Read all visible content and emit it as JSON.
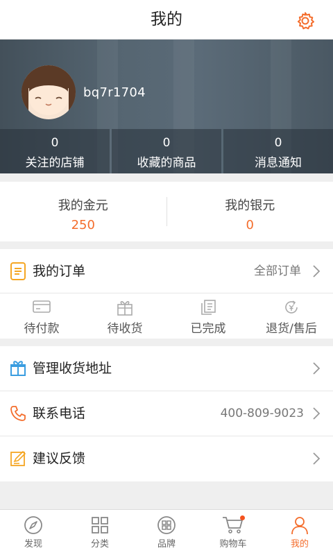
{
  "header": {
    "title": "我的",
    "settings_icon": "gear-icon"
  },
  "profile": {
    "username": "bq7r1704",
    "avatar_icon": "avatar-girl-icon"
  },
  "stats": [
    {
      "value": "0",
      "label": "关注的店铺"
    },
    {
      "value": "0",
      "label": "收藏的商品"
    },
    {
      "value": "0",
      "label": "消息通知"
    }
  ],
  "wallet": {
    "gold_label": "我的金元",
    "gold_value": "250",
    "silver_label": "我的银元",
    "silver_value": "0"
  },
  "orders": {
    "title": "我的订单",
    "all_label": "全部订单",
    "tabs": [
      {
        "label": "待付款",
        "icon": "card-icon"
      },
      {
        "label": "待收货",
        "icon": "gift-box-icon"
      },
      {
        "label": "已完成",
        "icon": "documents-icon"
      },
      {
        "label": "退货/售后",
        "icon": "refund-icon"
      }
    ]
  },
  "menu": [
    {
      "label": "管理收货地址",
      "right": "",
      "icon": "gift-icon"
    },
    {
      "label": "联系电话",
      "right": "400-809-9023",
      "icon": "phone-icon"
    },
    {
      "label": "建议反馈",
      "right": "",
      "icon": "feedback-icon"
    }
  ],
  "tabbar": [
    {
      "label": "发现",
      "icon": "compass-icon"
    },
    {
      "label": "分类",
      "icon": "grid-icon"
    },
    {
      "label": "品牌",
      "icon": "brand-icon"
    },
    {
      "label": "购物车",
      "icon": "cart-icon"
    },
    {
      "label": "我的",
      "icon": "person-icon"
    }
  ],
  "colors": {
    "accent": "#f46d2c",
    "hero": "#556571",
    "order_icon": "#f5a623",
    "address_icon": "#3a9de0",
    "phone_icon": "#f46d2c"
  }
}
